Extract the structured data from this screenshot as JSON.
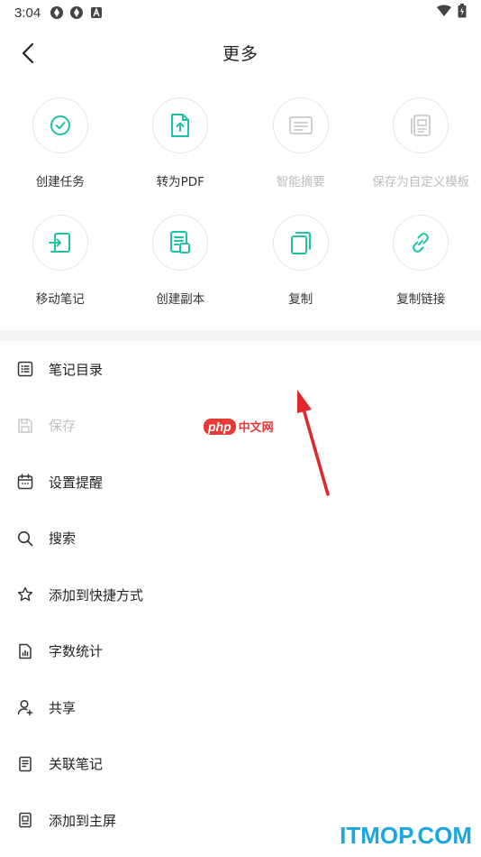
{
  "status_bar": {
    "time": "3:04"
  },
  "header": {
    "title": "更多"
  },
  "grid": [
    {
      "label": "创建任务",
      "icon": "check-circle-icon",
      "disabled": false
    },
    {
      "label": "转为PDF",
      "icon": "upload-file-icon",
      "disabled": false
    },
    {
      "label": "智能摘要",
      "icon": "summary-icon",
      "disabled": true
    },
    {
      "label": "保存为自定义模板",
      "icon": "template-icon",
      "disabled": true
    },
    {
      "label": "移动笔记",
      "icon": "move-note-icon",
      "disabled": false
    },
    {
      "label": "创建副本",
      "icon": "duplicate-doc-icon",
      "disabled": false
    },
    {
      "label": "复制",
      "icon": "copy-icon",
      "disabled": false
    },
    {
      "label": "复制链接",
      "icon": "link-icon",
      "disabled": false
    }
  ],
  "list": [
    {
      "label": "笔记目录",
      "icon": "list-icon",
      "disabled": false
    },
    {
      "label": "保存",
      "icon": "save-icon",
      "disabled": true
    },
    {
      "label": "设置提醒",
      "icon": "calendar-icon",
      "disabled": false
    },
    {
      "label": "搜索",
      "icon": "search-icon",
      "disabled": false
    },
    {
      "label": "添加到快捷方式",
      "icon": "star-icon",
      "disabled": false
    },
    {
      "label": "字数统计",
      "icon": "stats-doc-icon",
      "disabled": false
    },
    {
      "label": "共享",
      "icon": "share-user-icon",
      "disabled": false
    },
    {
      "label": "关联笔记",
      "icon": "linked-note-icon",
      "disabled": false
    },
    {
      "label": "添加到主屏",
      "icon": "homescreen-icon",
      "disabled": false
    }
  ],
  "watermarks": {
    "php_logo": "php",
    "php_text": "中文网",
    "itmop": "ITMOP.COM"
  },
  "colors": {
    "accent": "#1ec3a6",
    "disabled": "#c2c2c2",
    "divider": "#f3f3f3",
    "arrow": "#e0262a"
  }
}
